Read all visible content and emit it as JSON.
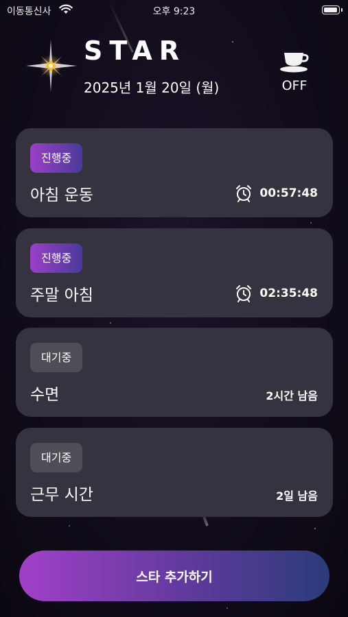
{
  "status_bar": {
    "carrier": "이동통신사",
    "time": "오후 9:23",
    "battery_level": 0.95
  },
  "header": {
    "logo_icon": "sparkle-star-icon",
    "title": "STAR",
    "date": "2025년 1월 20일 (월)",
    "coffee_icon": "coffee-cup-icon",
    "coffee_state": "OFF"
  },
  "cards": [
    {
      "status": "진행중",
      "status_type": "active",
      "title": "아침 운동",
      "timer": "00:57:48",
      "icon": "alarm-clock-icon"
    },
    {
      "status": "진행중",
      "status_type": "active",
      "title": "주말 아침",
      "timer": "02:35:48",
      "icon": "alarm-clock-icon"
    },
    {
      "status": "대기중",
      "status_type": "waiting",
      "title": "수면",
      "remaining": "2시간 남음"
    },
    {
      "status": "대기중",
      "status_type": "waiting",
      "title": "근무 시간",
      "remaining": "2일 남음"
    }
  ],
  "add_button": {
    "label": "스타 추가하기"
  },
  "colors": {
    "accent_purple": "#9b3fc7",
    "accent_blue": "#2b3c7a",
    "card_bg": "#34333f",
    "badge_waiting": "#4f4e56"
  }
}
